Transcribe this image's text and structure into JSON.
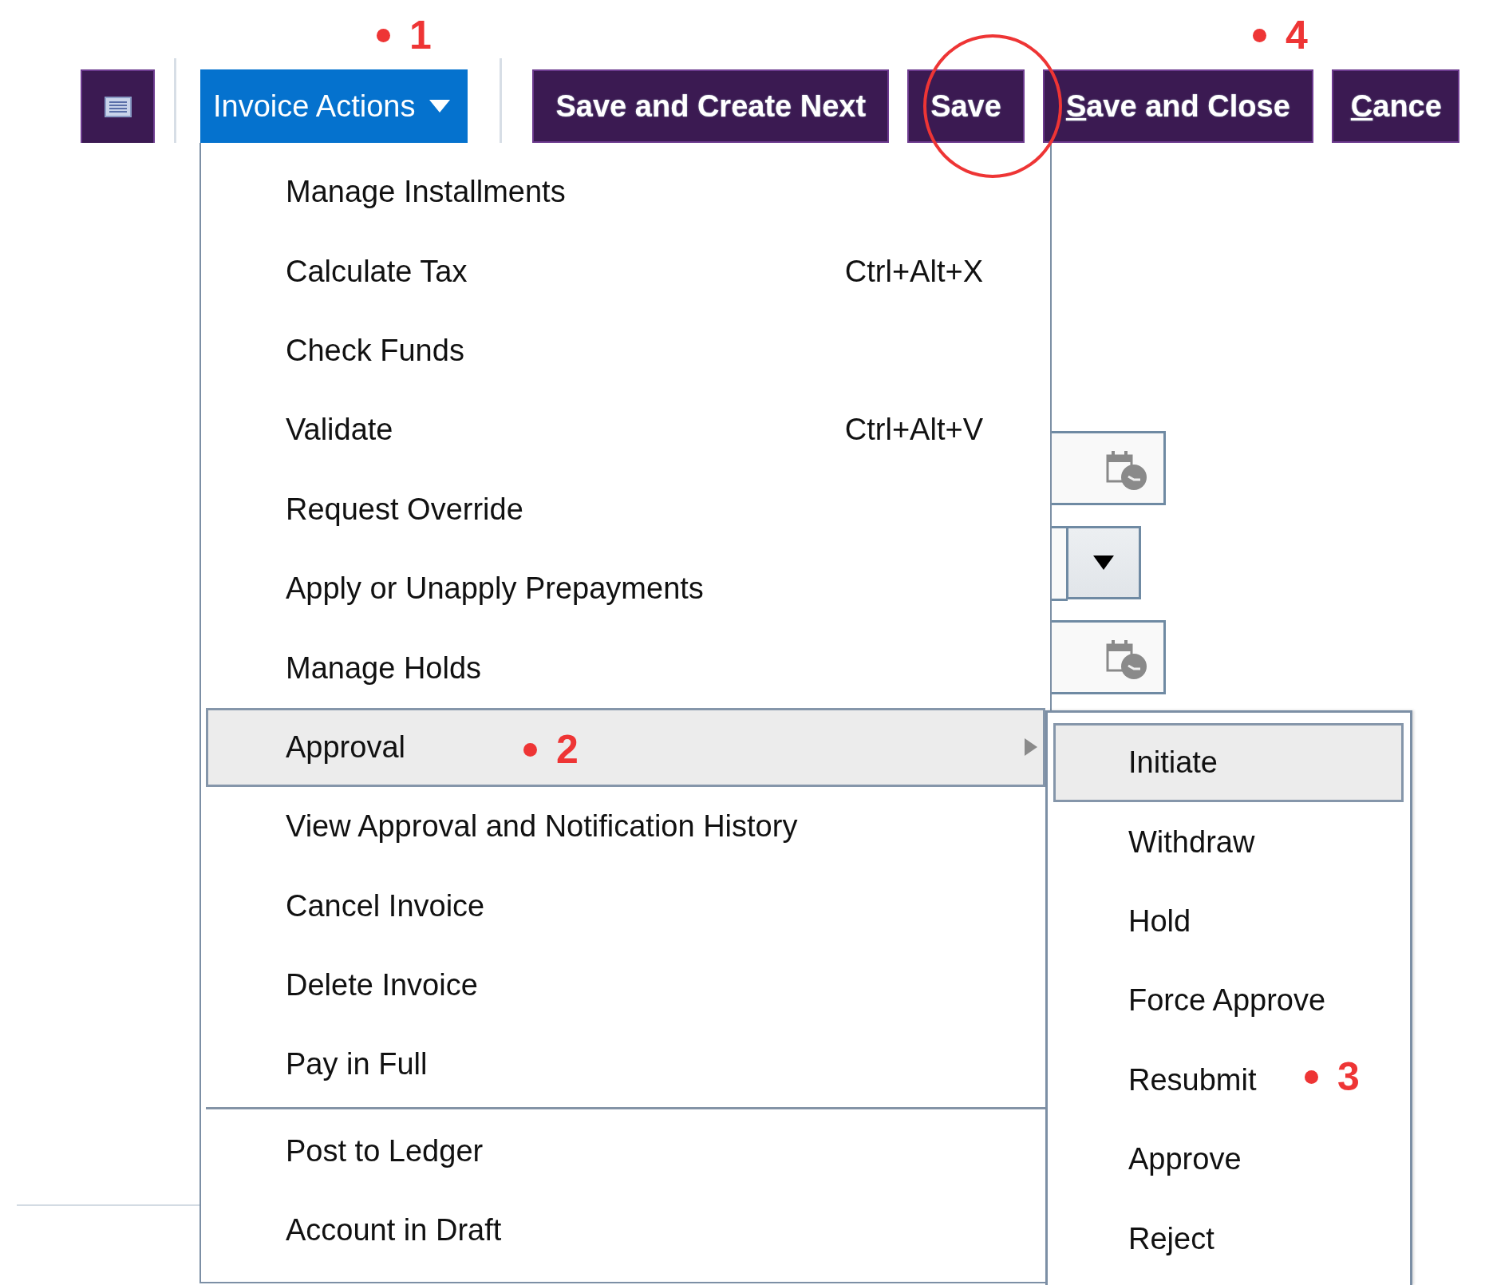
{
  "toolbar": {
    "invoice_actions": {
      "label": "Invoice Actions",
      "expanded": true
    },
    "buttons": [
      {
        "label": "Save and Create Next",
        "underline_first": false
      },
      {
        "label": "Save",
        "underline_first": false
      },
      {
        "label": "Save and Close",
        "underline_first": true
      },
      {
        "label": "Cance",
        "underline_first": true
      }
    ]
  },
  "menu": {
    "items": [
      {
        "label": "Manage Installments",
        "selected": false
      },
      {
        "label": "Calculate Tax",
        "shortcut": "Ctrl+Alt+X",
        "selected": false
      },
      {
        "label": "Check Funds",
        "selected": false
      },
      {
        "label": "Validate",
        "shortcut": "Ctrl+Alt+V",
        "selected": false
      },
      {
        "label": "Request Override",
        "selected": false
      },
      {
        "label": "Apply or Unapply Prepayments",
        "selected": false
      },
      {
        "label": "Manage Holds",
        "selected": false
      },
      {
        "label": "Approval",
        "selected": true,
        "has_submenu": true
      },
      {
        "label": "View Approval and Notification History",
        "selected": false
      },
      {
        "label": "Cancel Invoice",
        "selected": false
      },
      {
        "label": "Delete Invoice",
        "selected": false
      },
      {
        "label": "Pay in Full",
        "selected": false
      },
      {
        "label": "Post to Ledger",
        "selected": false,
        "separator_before": true
      },
      {
        "label": "Account in Draft",
        "selected": false
      }
    ]
  },
  "submenu": {
    "items": [
      {
        "label": "Initiate",
        "selected": true
      },
      {
        "label": "Withdraw",
        "selected": false
      },
      {
        "label": "Hold",
        "selected": false
      },
      {
        "label": "Force Approve",
        "selected": false
      },
      {
        "label": "Resubmit",
        "selected": false
      },
      {
        "label": "Approve",
        "selected": false
      },
      {
        "label": "Reject",
        "selected": false
      }
    ]
  },
  "annotations": [
    {
      "kind": "marker",
      "label": "1"
    },
    {
      "kind": "circle"
    },
    {
      "kind": "marker",
      "label": "4"
    },
    {
      "kind": "marker",
      "label": "2"
    },
    {
      "kind": "marker",
      "label": "3"
    }
  ]
}
